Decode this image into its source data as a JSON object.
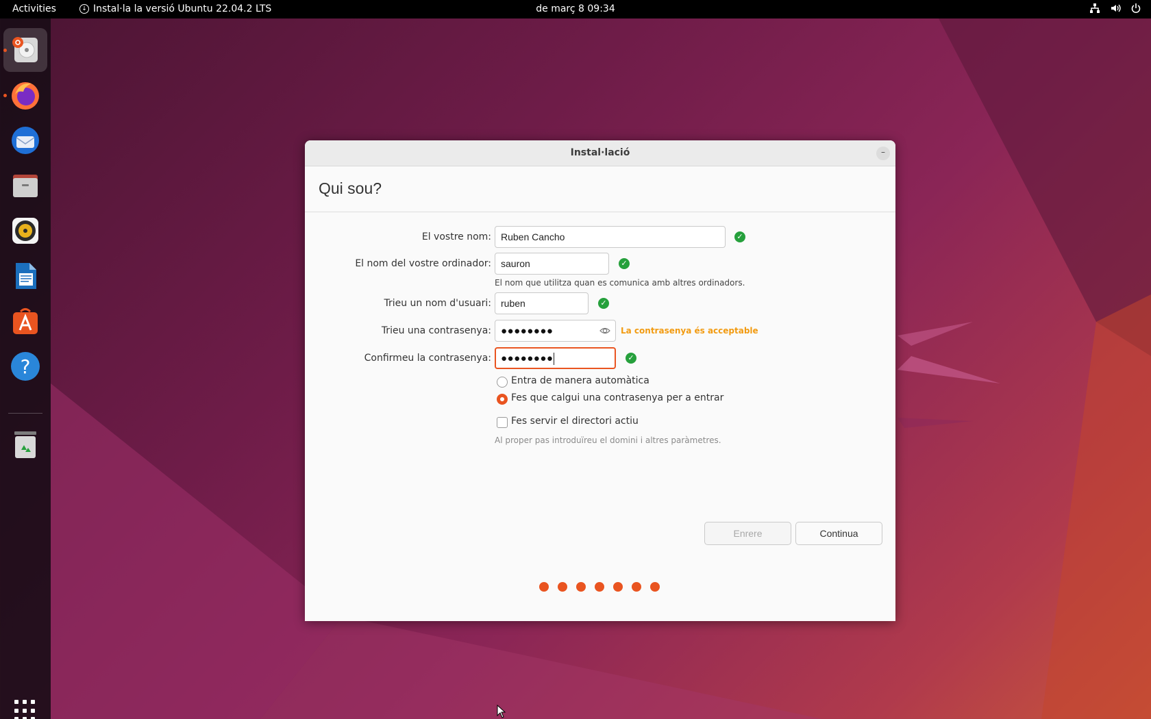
{
  "topbar": {
    "activities": "Activities",
    "app_menu_label": "Instal·la la versió Ubuntu 22.04.2 LTS",
    "clock": "de març 8  09:34",
    "tray_icons": [
      "network-icon",
      "volume-icon",
      "power-icon"
    ]
  },
  "dock": {
    "items": [
      {
        "name": "ubuntu-installer-icon",
        "running": true,
        "active": true
      },
      {
        "name": "firefox-icon",
        "running": true
      },
      {
        "name": "thunderbird-icon"
      },
      {
        "name": "files-icon"
      },
      {
        "name": "rhythmbox-icon"
      },
      {
        "name": "libreoffice-writer-icon"
      },
      {
        "name": "ubuntu-software-icon"
      },
      {
        "name": "help-icon"
      },
      {
        "name": "trash-icon"
      }
    ],
    "show_apps": "app-grid-icon"
  },
  "dialog": {
    "title": "Instal·lació",
    "minimize": "–",
    "heading": "Qui sou?",
    "name_label": "El vostre nom:",
    "name_value": "Ruben Cancho",
    "computer_label": "El nom del vostre ordinador:",
    "computer_value": "sauron",
    "computer_hint": "El nom que utilitza quan es comunica amb altres ordinadors.",
    "username_label": "Trieu un nom d'usuari:",
    "username_value": "ruben",
    "password_label": "Trieu una contrasenya:",
    "password_value": "●●●●●●●●",
    "password_strength": "La contrasenya és acceptable",
    "confirm_label": "Confirmeu la contrasenya:",
    "confirm_value": "●●●●●●●●",
    "login_auto": "Entra de manera automàtica",
    "login_password": "Fes que calgui una contrasenya per a entrar",
    "login_selected": "login_password",
    "active_directory": "Fes servir el directori actiu",
    "active_directory_checked": false,
    "active_directory_hint": "Al proper pas introduïreu el domini i altres paràmetres.",
    "back_button": "Enrere",
    "continue_button": "Continua",
    "progress_steps": 7
  },
  "colors": {
    "accent": "#e95420",
    "valid": "#26a03c",
    "strength": "#f29b11"
  }
}
